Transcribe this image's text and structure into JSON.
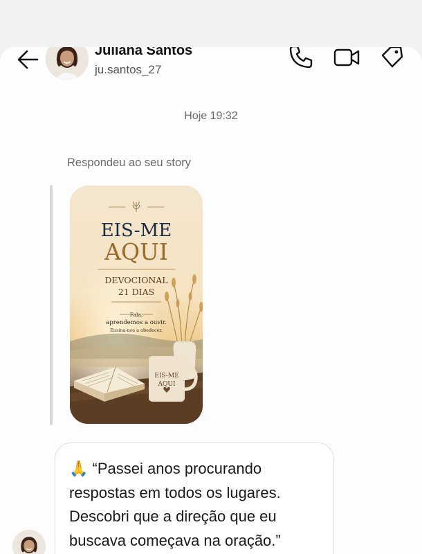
{
  "contact": {
    "name": "Juliana Santos",
    "username": "ju.santos_27"
  },
  "chat": {
    "timestamp": "Hoje 19:32",
    "reply_context": "Respondeu ao seu story",
    "story": {
      "title_line1": "EIS-ME",
      "title_line2": "AQUI",
      "subtitle_line1": "DEVOCIONAL",
      "subtitle_line2": "21 DIAS",
      "verse_line1": "Fala,",
      "verse_line2": "aprendemos a ouvir.",
      "verse_line3": "Ensina-nos a obedecer.",
      "mug_line1": "EIS-ME",
      "mug_line2": "AQUI"
    },
    "message": {
      "emoji": "🙏",
      "text": "“Passei anos procurando\nrespostas em todos os lugares.\nDescobri que a direção que eu\nbuscava começava na oração.”"
    }
  },
  "icons": {
    "back": "arrow-left-icon",
    "call": "phone-icon",
    "video": "video-camera-icon",
    "tag": "tag-icon"
  },
  "colors": {
    "title_navy": "#1d2b45",
    "title_gold": "#9a6a2a",
    "background": "#fdfdfd",
    "bubble_border": "#dedede"
  }
}
